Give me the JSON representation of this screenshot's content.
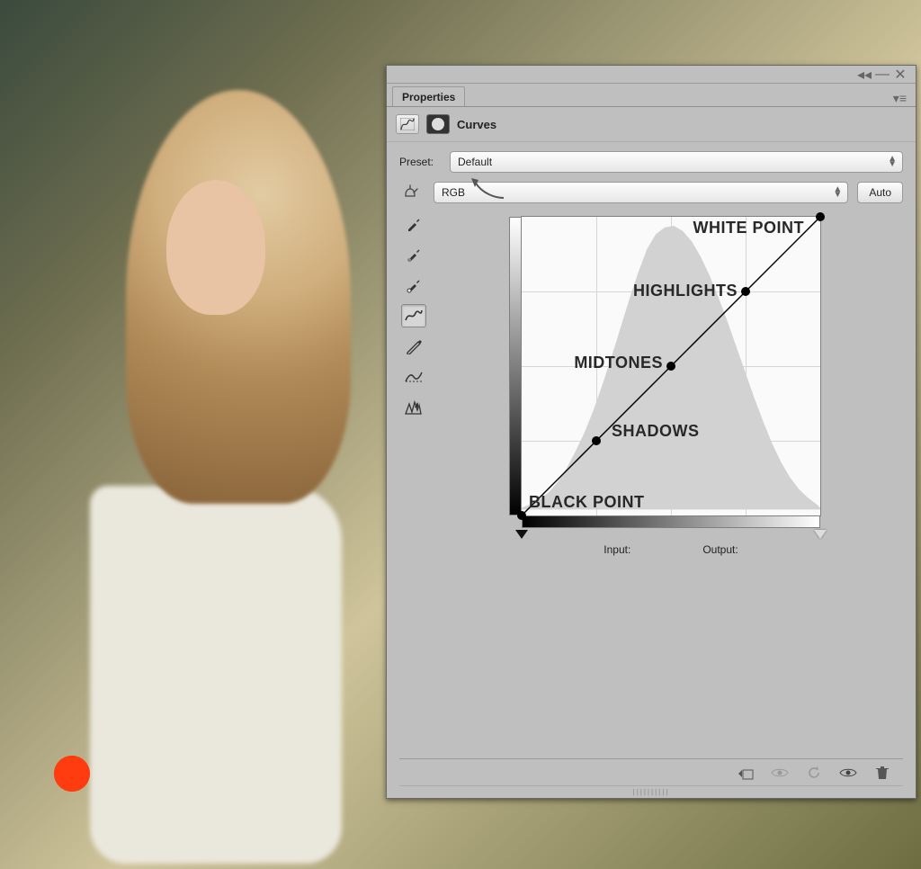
{
  "panel": {
    "tab": "Properties",
    "title": "Curves"
  },
  "preset": {
    "label": "Preset:",
    "value": "Default"
  },
  "channel": {
    "value": "RGB",
    "auto_label": "Auto"
  },
  "curve": {
    "input_label": "Input:",
    "output_label": "Output:",
    "white_point_label": "WHITE POINT",
    "highlights_label": "HIGHLIGHTS",
    "midtones_label": "MIDTONES",
    "shadows_label": "SHADOWS",
    "black_point_label": "BLACK POINT"
  },
  "chart_data": {
    "type": "line",
    "title": "Curves",
    "xlabel": "Input",
    "ylabel": "Output",
    "xlim": [
      0,
      255
    ],
    "ylim": [
      0,
      255
    ],
    "series": [
      {
        "name": "RGB",
        "x": [
          0,
          64,
          128,
          192,
          255
        ],
        "y": [
          0,
          64,
          128,
          192,
          255
        ]
      }
    ],
    "point_labels": [
      "BLACK POINT",
      "SHADOWS",
      "MIDTONES",
      "HIGHLIGHTS",
      "WHITE POINT"
    ],
    "histogram_bins_0_255": [
      0,
      1,
      2,
      3,
      4,
      6,
      8,
      10,
      12,
      14,
      16,
      20,
      24,
      30,
      36,
      42,
      48,
      56,
      64,
      74,
      84,
      96,
      108,
      120,
      134,
      148,
      160,
      172,
      186,
      200,
      214,
      226,
      236,
      242,
      248,
      252,
      255,
      252,
      246,
      238,
      226,
      212,
      198,
      184,
      170,
      156,
      142,
      128,
      116,
      104,
      94,
      84,
      76,
      68,
      60,
      54,
      48,
      44,
      40,
      36,
      32,
      29,
      26,
      24
    ]
  }
}
